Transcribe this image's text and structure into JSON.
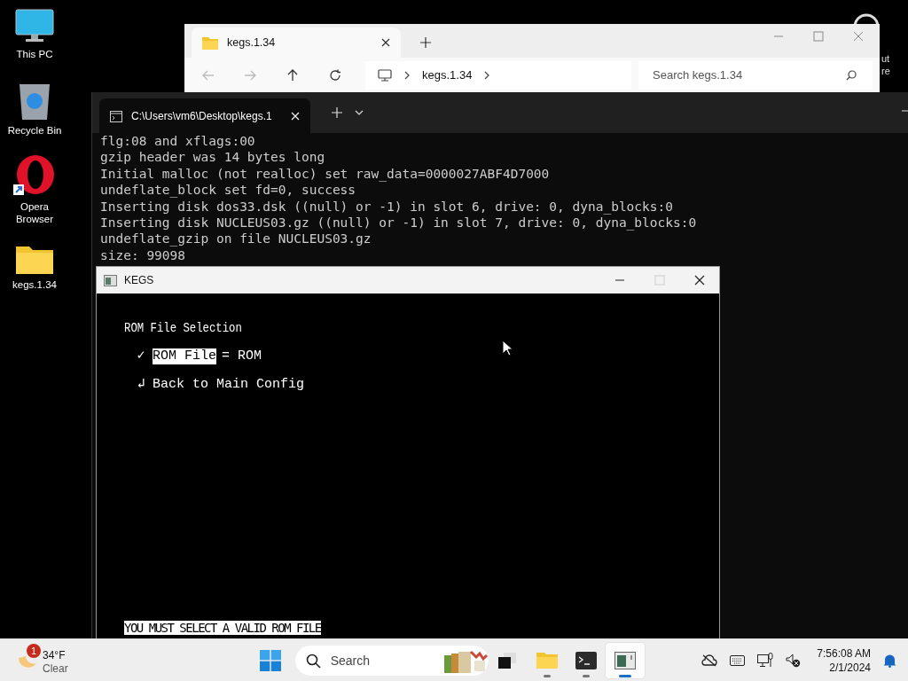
{
  "desktop_icons": [
    {
      "kind": "computer",
      "label": "This PC"
    },
    {
      "kind": "recycle",
      "label": "Recycle Bin"
    },
    {
      "kind": "opera",
      "label": "Opera Browser",
      "shortcut": true
    },
    {
      "kind": "folder",
      "label": "kegs.1.34"
    }
  ],
  "partial_icon": {
    "lines": [
      "ut",
      "re"
    ]
  },
  "explorer": {
    "tab": {
      "label": "kegs.1.34"
    },
    "nav": [
      {
        "kind": "back",
        "disabled": true
      },
      {
        "kind": "forward",
        "disabled": true
      },
      {
        "kind": "up",
        "disabled": false
      },
      {
        "kind": "refresh",
        "disabled": false
      }
    ],
    "breadcrumb": [
      "kegs.1.34"
    ],
    "search": {
      "placeholder": "Search kegs.1.34"
    }
  },
  "terminal": {
    "tab": {
      "label": "C:\\Users\\vm6\\Desktop\\kegs.1"
    },
    "lines": [
      "flg:08 and xflags:00",
      "gzip header was 14 bytes long",
      "Initial malloc (not realloc) set raw_data=0000027ABF4D7000",
      "undeflate_block set fd=0, success",
      "Inserting disk dos33.dsk ((null) or -1) in slot 6, drive: 0, dyna_blocks:0",
      "Inserting disk NUCLEUS03.gz ((null) or -1) in slot 7, drive: 0, dyna_blocks:0",
      "undeflate_gzip on file NUCLEUS03.gz",
      "size: 99098"
    ]
  },
  "kegs": {
    "title": "KEGS",
    "heading": "ROM File Selection",
    "items": [
      {
        "marker": "✓",
        "label": "ROM File",
        "value": "= ROM",
        "selected": true
      },
      {
        "marker": "↲",
        "label": "Back to Main Config",
        "selected": false
      }
    ],
    "status": "YOU MUST SELECT A VALID ROM FILE"
  },
  "taskbar": {
    "weather": {
      "badge": "1",
      "temp": "34°F",
      "condition": "Clear"
    },
    "search": {
      "placeholder": "Search"
    },
    "apps": [
      {
        "kind": "taskview",
        "running": false,
        "active": false
      },
      {
        "kind": "folder",
        "running": true,
        "active": false
      },
      {
        "kind": "terminal",
        "running": true,
        "active": false
      },
      {
        "kind": "emulator",
        "running": true,
        "active": true
      }
    ],
    "tray": [
      {
        "kind": "cloud"
      },
      {
        "kind": "keyboard"
      },
      {
        "kind": "network"
      },
      {
        "kind": "speaker"
      }
    ],
    "time": "7:56:08 AM",
    "date": "2/1/2024"
  }
}
